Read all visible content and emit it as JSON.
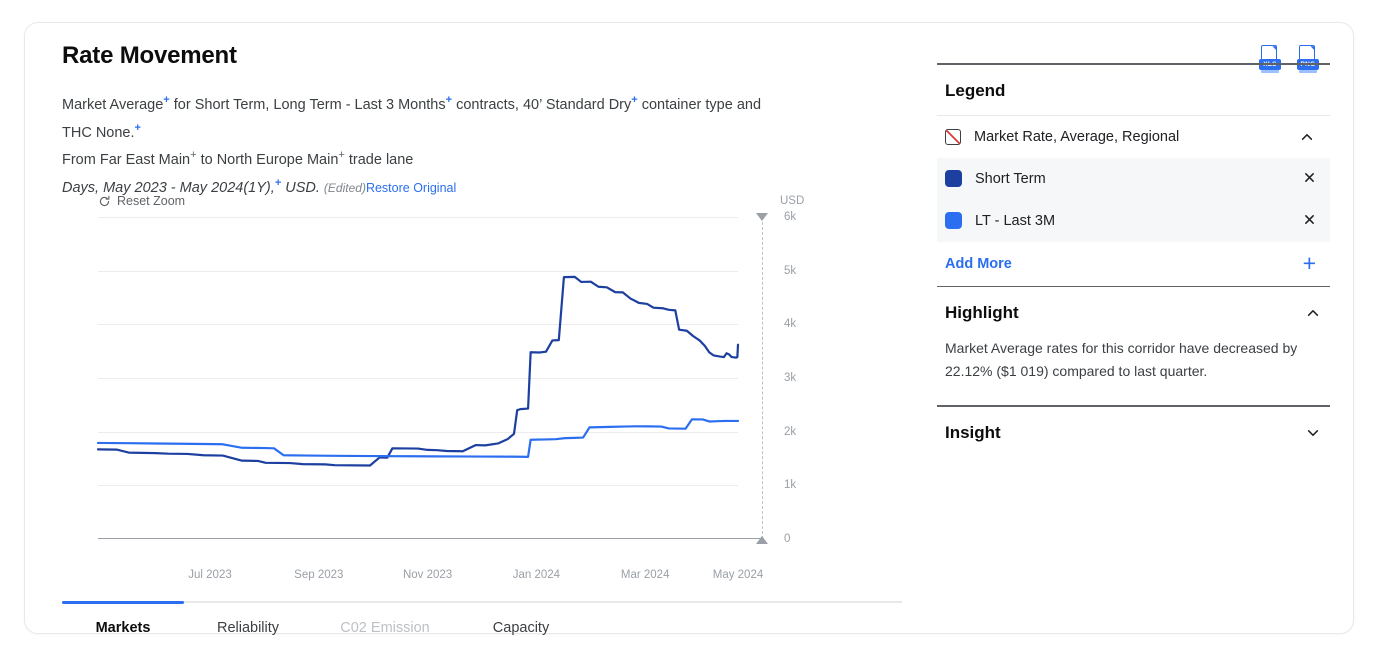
{
  "card": {
    "title": "Rate Movement",
    "description": {
      "line1_a": "Market Average",
      "line1_b": " for Short Term, Long Term - Last 3 Months",
      "line1_c": " contracts, 40’ Standard Dry",
      "line1_d": " container type and",
      "line2_a": "THC None.",
      "line3_a": "From Far East Main",
      "line3_b": " to North Europe Main",
      "line3_c": " trade lane",
      "line4_a": "Days",
      "line4_b": ", May 2023 - May 2024(1Y),",
      "line4_c": " USD.",
      "edited": "(Edited)",
      "restore": "Restore Original",
      "sup_marker": "+"
    }
  },
  "exports": [
    {
      "name": "xls-export-icon",
      "label": "XLS"
    },
    {
      "name": "png-export-icon",
      "label": "PNG"
    }
  ],
  "chart_controls": {
    "reset_zoom": "Reset Zoom"
  },
  "tabs": [
    {
      "label": "Markets",
      "state": "active",
      "width": 122
    },
    {
      "label": "Reliability",
      "state": "default",
      "width": 128
    },
    {
      "label": "C02 Emission",
      "state": "muted",
      "width": 146
    },
    {
      "label": "Capacity",
      "state": "default",
      "width": 126
    }
  ],
  "legend": {
    "title": "Legend",
    "collapse_icon": "chevron-up-icon",
    "items": [
      {
        "label": "Market Rate, Average, Regional",
        "swatch": "hatch",
        "color": "#ffffff",
        "action": "chevron-up-icon",
        "shaded": false
      },
      {
        "label": "Short Term",
        "swatch": "solid",
        "color": "#1C3FA0",
        "action": "close-icon",
        "shaded": true
      },
      {
        "label": "LT - Last 3M",
        "swatch": "solid",
        "color": "#2B6FF0",
        "action": "close-icon",
        "shaded": true
      }
    ],
    "add_more": "Add More",
    "add_icon": "plus-icon"
  },
  "highlight": {
    "title": "Highlight",
    "collapse_icon": "chevron-up-icon",
    "text": "Market Average rates for this corridor have decreased by 22.12% ($1 019) compared to last quarter."
  },
  "insight": {
    "title": "Insight",
    "collapse_icon": "chevron-down-icon"
  },
  "chart_data": {
    "type": "line",
    "title": "Rate Movement",
    "xlabel": "",
    "ylabel": "USD",
    "ylim": [
      0,
      6000
    ],
    "yticks": [
      0,
      1000,
      2000,
      3000,
      4000,
      5000,
      6000
    ],
    "ytick_labels": [
      "0",
      "1k",
      "2k",
      "3k",
      "4k",
      "5k",
      "6k"
    ],
    "xticks": [
      "Jul 2023",
      "Sep 2023",
      "Nov 2023",
      "Jan 2024",
      "Mar 2024",
      "May 2024"
    ],
    "xlim": [
      "May 2023",
      "May 2024"
    ],
    "grid": true,
    "legend_position": "right-panel",
    "currency": "USD",
    "series": [
      {
        "name": "Short Term",
        "color": "#1C3FA0",
        "points": [
          [
            0.0,
            1670
          ],
          [
            0.03,
            1665
          ],
          [
            0.048,
            1610
          ],
          [
            0.09,
            1600
          ],
          [
            0.11,
            1590
          ],
          [
            0.14,
            1585
          ],
          [
            0.165,
            1560
          ],
          [
            0.195,
            1555
          ],
          [
            0.225,
            1460
          ],
          [
            0.25,
            1455
          ],
          [
            0.262,
            1420
          ],
          [
            0.3,
            1415
          ],
          [
            0.32,
            1395
          ],
          [
            0.355,
            1390
          ],
          [
            0.37,
            1375
          ],
          [
            0.425,
            1370
          ],
          [
            0.44,
            1520
          ],
          [
            0.452,
            1515
          ],
          [
            0.46,
            1690
          ],
          [
            0.5,
            1685
          ],
          [
            0.515,
            1660
          ],
          [
            0.53,
            1655
          ],
          [
            0.545,
            1640
          ],
          [
            0.57,
            1635
          ],
          [
            0.59,
            1750
          ],
          [
            0.605,
            1745
          ],
          [
            0.625,
            1780
          ],
          [
            0.64,
            1860
          ],
          [
            0.65,
            1960
          ],
          [
            0.655,
            2400
          ],
          [
            0.66,
            2420
          ],
          [
            0.672,
            2430
          ],
          [
            0.676,
            3480
          ],
          [
            0.69,
            3475
          ],
          [
            0.7,
            3490
          ],
          [
            0.71,
            3700
          ],
          [
            0.72,
            3705
          ],
          [
            0.728,
            4880
          ],
          [
            0.745,
            4885
          ],
          [
            0.755,
            4790
          ],
          [
            0.77,
            4795
          ],
          [
            0.782,
            4700
          ],
          [
            0.795,
            4690
          ],
          [
            0.808,
            4600
          ],
          [
            0.82,
            4595
          ],
          [
            0.832,
            4480
          ],
          [
            0.845,
            4400
          ],
          [
            0.858,
            4380
          ],
          [
            0.868,
            4310
          ],
          [
            0.882,
            4300
          ],
          [
            0.892,
            4270
          ],
          [
            0.902,
            4260
          ],
          [
            0.908,
            3900
          ],
          [
            0.92,
            3880
          ],
          [
            0.93,
            3780
          ],
          [
            0.94,
            3700
          ],
          [
            0.948,
            3600
          ],
          [
            0.955,
            3480
          ],
          [
            0.962,
            3420
          ],
          [
            0.972,
            3400
          ],
          [
            0.978,
            3390
          ],
          [
            0.982,
            3460
          ],
          [
            0.986,
            3440
          ],
          [
            0.99,
            3390
          ],
          [
            0.994,
            3385
          ],
          [
            0.997,
            3380
          ],
          [
            0.999,
            3390
          ],
          [
            1.0,
            3620
          ]
        ]
      },
      {
        "name": "LT - Last 3M",
        "color": "#2B6FF0",
        "points": [
          [
            0.0,
            1790
          ],
          [
            0.05,
            1785
          ],
          [
            0.09,
            1780
          ],
          [
            0.13,
            1775
          ],
          [
            0.165,
            1770
          ],
          [
            0.195,
            1765
          ],
          [
            0.225,
            1700
          ],
          [
            0.262,
            1695
          ],
          [
            0.275,
            1690
          ],
          [
            0.29,
            1560
          ],
          [
            0.33,
            1555
          ],
          [
            0.37,
            1550
          ],
          [
            0.4,
            1548
          ],
          [
            0.43,
            1545
          ],
          [
            0.46,
            1543
          ],
          [
            0.49,
            1542
          ],
          [
            0.52,
            1540
          ],
          [
            0.56,
            1538
          ],
          [
            0.6,
            1536
          ],
          [
            0.63,
            1535
          ],
          [
            0.66,
            1533
          ],
          [
            0.672,
            1531
          ],
          [
            0.676,
            1850
          ],
          [
            0.7,
            1855
          ],
          [
            0.715,
            1860
          ],
          [
            0.73,
            1880
          ],
          [
            0.745,
            1885
          ],
          [
            0.758,
            1890
          ],
          [
            0.768,
            2080
          ],
          [
            0.785,
            2085
          ],
          [
            0.8,
            2090
          ],
          [
            0.82,
            2095
          ],
          [
            0.84,
            2100
          ],
          [
            0.86,
            2098
          ],
          [
            0.88,
            2095
          ],
          [
            0.892,
            2060
          ],
          [
            0.905,
            2058
          ],
          [
            0.918,
            2055
          ],
          [
            0.928,
            2230
          ],
          [
            0.945,
            2228
          ],
          [
            0.955,
            2190
          ],
          [
            0.968,
            2195
          ],
          [
            0.98,
            2200
          ],
          [
            1.0,
            2200
          ]
        ]
      }
    ]
  }
}
